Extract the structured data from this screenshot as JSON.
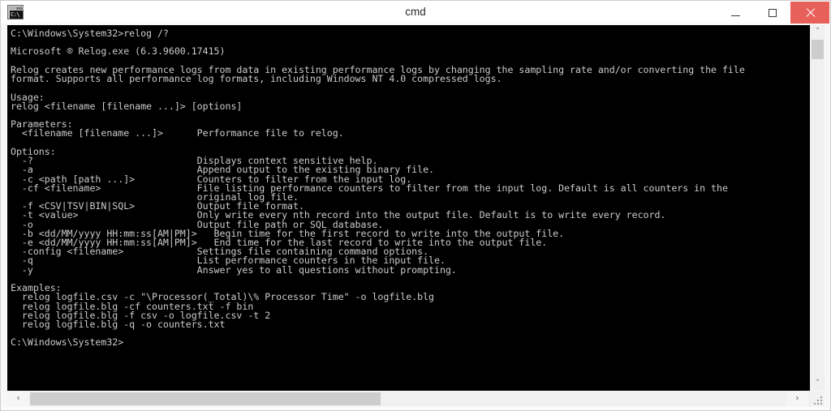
{
  "window": {
    "title": "cmd",
    "app_icon_text": "C:\\",
    "icon_name": "cmd-console-icon",
    "caption": {
      "minimize_label": "–",
      "maximize_label": "□",
      "close_label": "×"
    },
    "colors": {
      "titlebar_bg": "#ffffff",
      "title_fg": "#2b2b2b",
      "close_bg": "#e8605a",
      "console_bg": "#000000",
      "console_fg": "#cccccc",
      "scrollbar_track": "#f0f0f0",
      "scrollbar_thumb": "#cdcdcd",
      "window_border": "#cfcfcf"
    }
  },
  "console": {
    "prompt_initial": "C:\\Windows\\System32>",
    "command": "relog /?",
    "prompt_final": "C:\\Windows\\System32>",
    "banner": "Microsoft ® Relog.exe (6.3.9600.17415)",
    "description_lines": [
      "Relog creates new performance logs from data in existing performance logs by changing the sampling rate and/or converting the file",
      "format. Supports all performance log formats, including Windows NT 4.0 compressed logs."
    ],
    "usage_heading": "Usage:",
    "usage_line": "relog <filename [filename ...]> [options]",
    "parameters_heading": "Parameters:",
    "parameters": [
      {
        "name": "  <filename [filename ...]>",
        "description": "Performance file to relog."
      }
    ],
    "options_heading": "Options:",
    "options": [
      {
        "name": "  -?",
        "description": "Displays context sensitive help."
      },
      {
        "name": "  -a",
        "description": "Append output to the existing binary file."
      },
      {
        "name": "  -c <path [path ...]>",
        "description": "Counters to filter from the input log."
      },
      {
        "name": "  -cf <filename>",
        "description": "File listing performance counters to filter from the input log. Default is all counters in the"
      },
      {
        "name": "",
        "description": "original log file."
      },
      {
        "name": "  -f <CSV|TSV|BIN|SQL>",
        "description": "Output file format."
      },
      {
        "name": "  -t <value>",
        "description": "Only write every nth record into the output file. Default is to write every record."
      },
      {
        "name": "  -o",
        "description": "Output file path or SQL database."
      },
      {
        "name": "  -b <dd/MM/yyyy HH:mm:ss[AM|PM]>",
        "description": "Begin time for the first record to write into the output file."
      },
      {
        "name": "  -e <dd/MM/yyyy HH:mm:ss[AM|PM]>",
        "description": "End time for the last record to write into the output file."
      },
      {
        "name": "  -config <filename>",
        "description": "Settings file containing command options."
      },
      {
        "name": "  -q",
        "description": "List performance counters in the input file."
      },
      {
        "name": "  -y",
        "description": "Answer yes to all questions without prompting."
      }
    ],
    "examples_heading": "Examples:",
    "examples": [
      "  relog logfile.csv -c \"\\Processor(_Total)\\% Processor Time\" -o logfile.blg",
      "  relog logfile.blg -cf counters.txt -f bin",
      "  relog logfile.blg -f csv -o logfile.csv -t 2",
      "  relog logfile.blg -q -o counters.txt"
    ],
    "full_text": "C:\\Windows\\System32>relog /?\n\nMicrosoft ® Relog.exe (6.3.9600.17415)\n\nRelog creates new performance logs from data in existing performance logs by changing the sampling rate and/or converting the file\nformat. Supports all performance log formats, including Windows NT 4.0 compressed logs.\n\nUsage:\nrelog <filename [filename ...]> [options]\n\nParameters:\n  <filename [filename ...]>      Performance file to relog.\n\nOptions:\n  -?                             Displays context sensitive help.\n  -a                             Append output to the existing binary file.\n  -c <path [path ...]>           Counters to filter from the input log.\n  -cf <filename>                 File listing performance counters to filter from the input log. Default is all counters in the\n                                 original log file.\n  -f <CSV|TSV|BIN|SQL>           Output file format.\n  -t <value>                     Only write every nth record into the output file. Default is to write every record.\n  -o                             Output file path or SQL database.\n  -b <dd/MM/yyyy HH:mm:ss[AM|PM]>   Begin time for the first record to write into the output file.\n  -e <dd/MM/yyyy HH:mm:ss[AM|PM]>   End time for the last record to write into the output file.\n  -config <filename>             Settings file containing command options.\n  -q                             List performance counters in the input file.\n  -y                             Answer yes to all questions without prompting.\n\nExamples:\n  relog logfile.csv -c \"\\Processor(_Total)\\% Processor Time\" -o logfile.blg\n  relog logfile.blg -cf counters.txt -f bin\n  relog logfile.blg -f csv -o logfile.csv -t 2\n  relog logfile.blg -q -o counters.txt\n\nC:\\Windows\\System32>"
  },
  "scrollbars": {
    "vertical": {
      "up_arrow": "˄",
      "down_arrow": "˅"
    },
    "horizontal": {
      "left_arrow": "‹",
      "right_arrow": "›"
    }
  }
}
